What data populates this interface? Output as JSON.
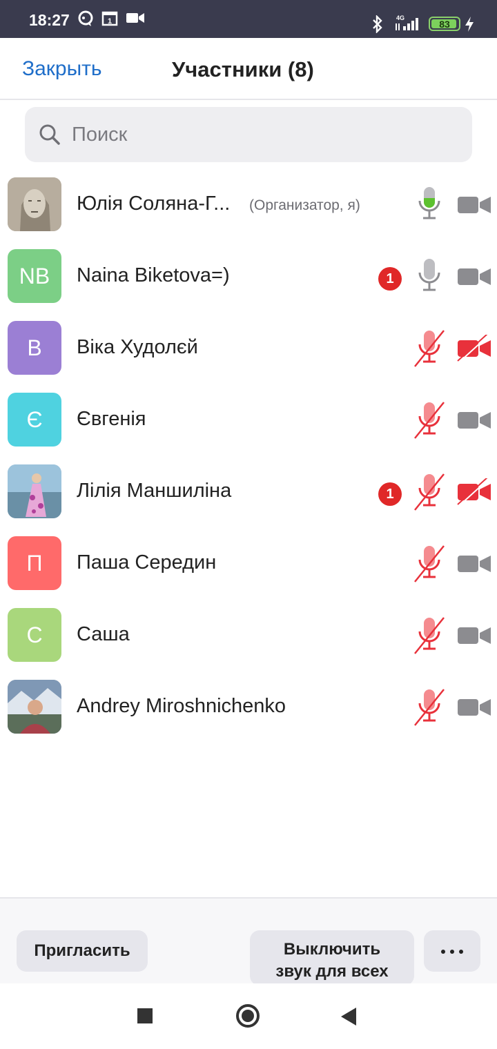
{
  "status_bar": {
    "time": "18:27",
    "network": "4G",
    "battery": "83",
    "icons": [
      "chat-bubble-icon",
      "calendar-icon",
      "video-icon",
      "bluetooth-icon",
      "signal-icon",
      "battery-icon",
      "charging-icon"
    ]
  },
  "header": {
    "close_label": "Закрыть",
    "title": "Участники (8)"
  },
  "search": {
    "placeholder": "Поиск",
    "value": ""
  },
  "participants": [
    {
      "name": "Юлія Соляна-Г...",
      "role": "(Организатор, я)",
      "avatar_type": "photo-sketch",
      "avatar_text": "",
      "avatar_color": "#b7ad9e",
      "badge": "",
      "mic": "active",
      "camera": "on"
    },
    {
      "name": "Naina Biketova=)",
      "role": "",
      "avatar_type": "initials",
      "avatar_text": "NB",
      "avatar_color": "#7ccf86",
      "badge": "1",
      "mic": "on",
      "camera": "on"
    },
    {
      "name": "Віка Худолєй",
      "role": "",
      "avatar_type": "initials",
      "avatar_text": "В",
      "avatar_color": "#9b7fd4",
      "badge": "",
      "mic": "muted",
      "camera": "off"
    },
    {
      "name": "Євгенія",
      "role": "",
      "avatar_type": "initials",
      "avatar_text": "Є",
      "avatar_color": "#4fd2e0",
      "badge": "",
      "mic": "muted",
      "camera": "on"
    },
    {
      "name": "Лілія Маншиліна",
      "role": "",
      "avatar_type": "photo-beach",
      "avatar_text": "",
      "avatar_color": "#9cc3dc",
      "badge": "1",
      "mic": "muted",
      "camera": "off"
    },
    {
      "name": "Паша Середин",
      "role": "",
      "avatar_type": "initials",
      "avatar_text": "П",
      "avatar_color": "#ff6a6a",
      "badge": "",
      "mic": "muted",
      "camera": "on"
    },
    {
      "name": "Саша",
      "role": "",
      "avatar_type": "initials",
      "avatar_text": "С",
      "avatar_color": "#a9d77c",
      "badge": "",
      "mic": "muted",
      "camera": "on"
    },
    {
      "name": "Andrey Miroshnichenko",
      "role": "",
      "avatar_type": "photo-mountain",
      "avatar_text": "",
      "avatar_color": "#7f98b5",
      "badge": "",
      "mic": "muted",
      "camera": "on"
    }
  ],
  "footer": {
    "invite_label": "Пригласить",
    "mute_all_line1": "Выключить",
    "mute_all_line2": "звук для всех",
    "more_icon": "more-dots-icon"
  },
  "colors": {
    "accent_blue": "#1f6ec9",
    "muted_red": "#e8313b",
    "active_green": "#5cc12f",
    "icon_gray": "#8c8c90",
    "badge_red": "#e02828"
  }
}
